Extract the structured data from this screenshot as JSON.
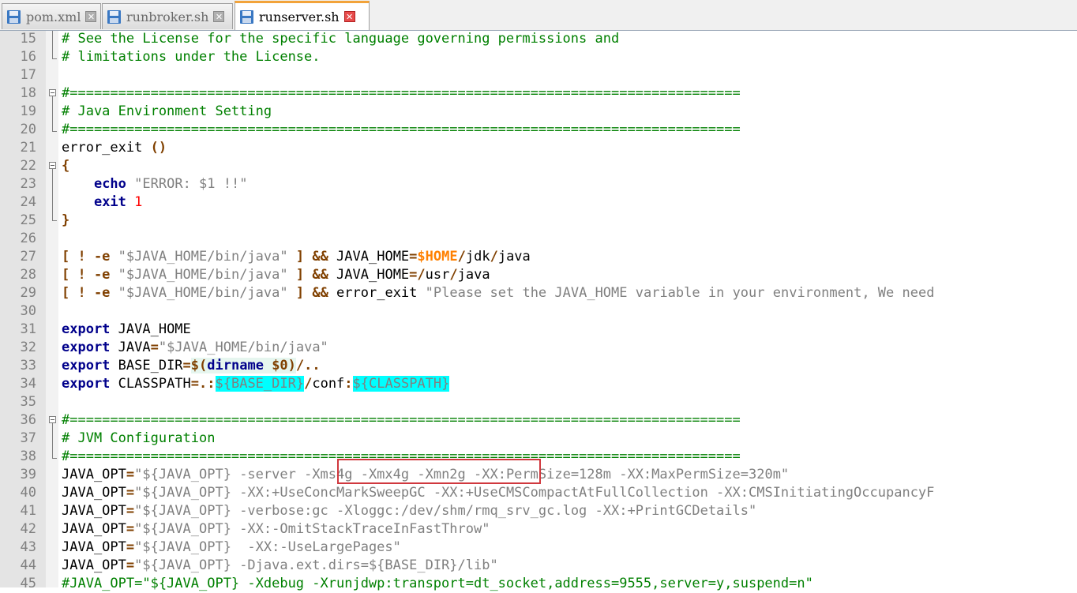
{
  "tabs": [
    {
      "label": "pom.xml",
      "icon": "save-icon",
      "active": false
    },
    {
      "label": "runbroker.sh",
      "icon": "save-icon",
      "active": false
    },
    {
      "label": "runserver.sh",
      "icon": "save-icon",
      "active": true
    }
  ],
  "editor": {
    "line_numbers": [
      "15",
      "16",
      "17",
      "18",
      "19",
      "20",
      "21",
      "22",
      "23",
      "24",
      "25",
      "26",
      "27",
      "28",
      "29",
      "30",
      "31",
      "32",
      "33",
      "34",
      "35",
      "36",
      "37",
      "38",
      "39",
      "40",
      "41",
      "42",
      "43",
      "44",
      "45"
    ],
    "lines": [
      [
        {
          "c": "cm",
          "t": "# See the License for the specific language governing permissions and"
        }
      ],
      [
        {
          "c": "cm",
          "t": "# limitations under the License."
        }
      ],
      [],
      [
        {
          "c": "cm",
          "t": "#==================================================================================="
        }
      ],
      [
        {
          "c": "cm",
          "t": "# Java Environment Setting"
        }
      ],
      [
        {
          "c": "cm",
          "t": "#==================================================================================="
        }
      ],
      [
        {
          "c": "",
          "t": "error_exit "
        },
        {
          "c": "op",
          "t": "()"
        }
      ],
      [
        {
          "c": "op",
          "t": "{"
        }
      ],
      [
        {
          "c": "",
          "t": "    "
        },
        {
          "c": "kw",
          "t": "echo"
        },
        {
          "c": "",
          "t": " "
        },
        {
          "c": "st",
          "t": "\"ERROR: $1 !!\""
        }
      ],
      [
        {
          "c": "",
          "t": "    "
        },
        {
          "c": "kw",
          "t": "exit"
        },
        {
          "c": "",
          "t": " "
        },
        {
          "c": "num",
          "t": "1"
        }
      ],
      [
        {
          "c": "op",
          "t": "}"
        }
      ],
      [],
      [
        {
          "c": "op",
          "t": "[ ! -e"
        },
        {
          "c": "",
          "t": " "
        },
        {
          "c": "st",
          "t": "\"$JAVA_HOME/bin/java\""
        },
        {
          "c": "",
          "t": " "
        },
        {
          "c": "op",
          "t": "] &&"
        },
        {
          "c": "",
          "t": " JAVA_HOME"
        },
        {
          "c": "op",
          "t": "="
        },
        {
          "c": "var",
          "t": "$HOME"
        },
        {
          "c": "op",
          "t": "/"
        },
        {
          "c": "",
          "t": "jdk"
        },
        {
          "c": "op",
          "t": "/"
        },
        {
          "c": "",
          "t": "java"
        }
      ],
      [
        {
          "c": "op",
          "t": "[ ! -e"
        },
        {
          "c": "",
          "t": " "
        },
        {
          "c": "st",
          "t": "\"$JAVA_HOME/bin/java\""
        },
        {
          "c": "",
          "t": " "
        },
        {
          "c": "op",
          "t": "] &&"
        },
        {
          "c": "",
          "t": " JAVA_HOME"
        },
        {
          "c": "op",
          "t": "=/"
        },
        {
          "c": "",
          "t": "usr"
        },
        {
          "c": "op",
          "t": "/"
        },
        {
          "c": "",
          "t": "java"
        }
      ],
      [
        {
          "c": "op",
          "t": "[ ! -e"
        },
        {
          "c": "",
          "t": " "
        },
        {
          "c": "st",
          "t": "\"$JAVA_HOME/bin/java\""
        },
        {
          "c": "",
          "t": " "
        },
        {
          "c": "op",
          "t": "] &&"
        },
        {
          "c": "",
          "t": " error_exit "
        },
        {
          "c": "st",
          "t": "\"Please set the JAVA_HOME variable in your environment, We need"
        }
      ],
      [],
      [
        {
          "c": "kw",
          "t": "export"
        },
        {
          "c": "",
          "t": " JAVA_HOME"
        }
      ],
      [
        {
          "c": "kw",
          "t": "export"
        },
        {
          "c": "",
          "t": " JAVA"
        },
        {
          "c": "op",
          "t": "="
        },
        {
          "c": "st",
          "t": "\"$JAVA_HOME/bin/java\""
        }
      ],
      [
        {
          "c": "kw",
          "t": "export"
        },
        {
          "c": "",
          "t": " BASE_DIR"
        },
        {
          "c": "op",
          "t": "="
        },
        {
          "c": "op sub",
          "t": "$("
        },
        {
          "c": "kw sub",
          "t": "dirname"
        },
        {
          "c": "sub",
          "t": " "
        },
        {
          "c": "op sub",
          "t": "$0)"
        },
        {
          "c": "op",
          "t": "/.."
        }
      ],
      [
        {
          "c": "kw",
          "t": "export"
        },
        {
          "c": "",
          "t": " CLASSPATH"
        },
        {
          "c": "op",
          "t": "=.:"
        },
        {
          "c": "hl",
          "t": "${BASE_DIR}"
        },
        {
          "c": "op",
          "t": "/"
        },
        {
          "c": "",
          "t": "conf"
        },
        {
          "c": "op",
          "t": ":"
        },
        {
          "c": "hl",
          "t": "${CLASSPATH}"
        }
      ],
      [],
      [
        {
          "c": "cm",
          "t": "#==================================================================================="
        }
      ],
      [
        {
          "c": "cm",
          "t": "# JVM Configuration"
        }
      ],
      [
        {
          "c": "cm",
          "t": "#==================================================================================="
        }
      ],
      [
        {
          "c": "",
          "t": "JAVA_OPT"
        },
        {
          "c": "op",
          "t": "="
        },
        {
          "c": "st",
          "t": "\"${JAVA_OPT} -server -Xms4g -Xmx4g -Xmn2g -XX:PermSize=128m -XX:MaxPermSize=320m\""
        }
      ],
      [
        {
          "c": "",
          "t": "JAVA_OPT"
        },
        {
          "c": "op",
          "t": "="
        },
        {
          "c": "st",
          "t": "\"${JAVA_OPT} -XX:+UseConcMarkSweepGC -XX:+UseCMSCompactAtFullCollection -XX:CMSInitiatingOccupancyF"
        }
      ],
      [
        {
          "c": "",
          "t": "JAVA_OPT"
        },
        {
          "c": "op",
          "t": "="
        },
        {
          "c": "st",
          "t": "\"${JAVA_OPT} -verbose:gc -Xloggc:/dev/shm/rmq_srv_gc.log -XX:+PrintGCDetails\""
        }
      ],
      [
        {
          "c": "",
          "t": "JAVA_OPT"
        },
        {
          "c": "op",
          "t": "="
        },
        {
          "c": "st",
          "t": "\"${JAVA_OPT} -XX:-OmitStackTraceInFastThrow\""
        }
      ],
      [
        {
          "c": "",
          "t": "JAVA_OPT"
        },
        {
          "c": "op",
          "t": "="
        },
        {
          "c": "st",
          "t": "\"${JAVA_OPT}  -XX:-UseLargePages\""
        }
      ],
      [
        {
          "c": "",
          "t": "JAVA_OPT"
        },
        {
          "c": "op",
          "t": "="
        },
        {
          "c": "st",
          "t": "\"${JAVA_OPT} -Djava.ext.dirs=${BASE_DIR}/lib\""
        }
      ],
      [
        {
          "c": "cm",
          "t": "#JAVA_OPT=\"${JAVA_OPT} -Xdebug -Xrunjdwp:transport=dt_socket,address=9555,server=y,suspend=n\""
        }
      ]
    ],
    "highlight": {
      "label": "-Xms4g -Xmx4g -Xmn2g",
      "color": "#d0383e"
    }
  }
}
